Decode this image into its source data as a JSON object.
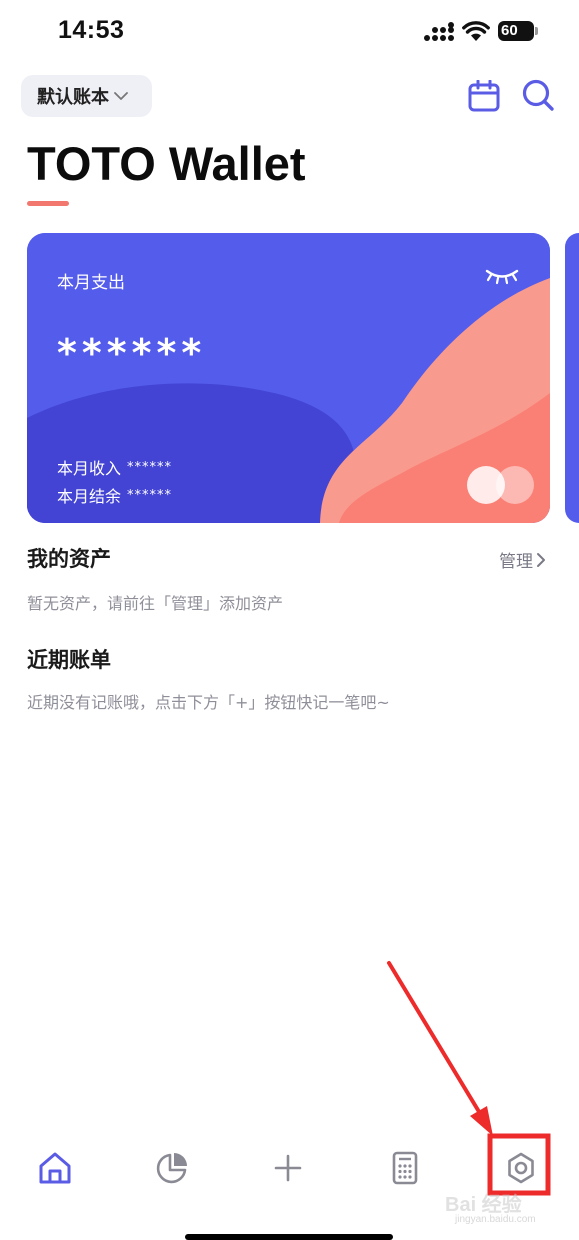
{
  "status_bar": {
    "time": "14:53",
    "battery": "60"
  },
  "header": {
    "ledger_label": "默认账本",
    "app_title": "TOTO Wallet"
  },
  "card": {
    "expense_label": "本月支出",
    "expense_value": "******",
    "income_label": "本月收入",
    "income_value": "******",
    "balance_label": "本月结余",
    "balance_value": "******"
  },
  "assets": {
    "title": "我的资产",
    "manage_label": "管理",
    "empty_text": "暂无资产，请前往「管理」添加资产"
  },
  "bills": {
    "title": "近期账单",
    "empty_text": "近期没有记账哦，点击下方「+」按钮快记一笔吧~"
  },
  "tabbar": {
    "items": [
      {
        "icon": "home-icon"
      },
      {
        "icon": "pie-chart-icon"
      },
      {
        "icon": "plus-icon"
      },
      {
        "icon": "calculator-icon"
      },
      {
        "icon": "settings-icon"
      }
    ]
  },
  "watermark": {
    "text": "Bai 经验",
    "sub": "jingyan.baidu.com"
  },
  "colors": {
    "accent": "#5b5ce6",
    "card_blue": "#545ceb",
    "card_coral": "#f87c72",
    "annotation_red": "#ee2b2b"
  }
}
